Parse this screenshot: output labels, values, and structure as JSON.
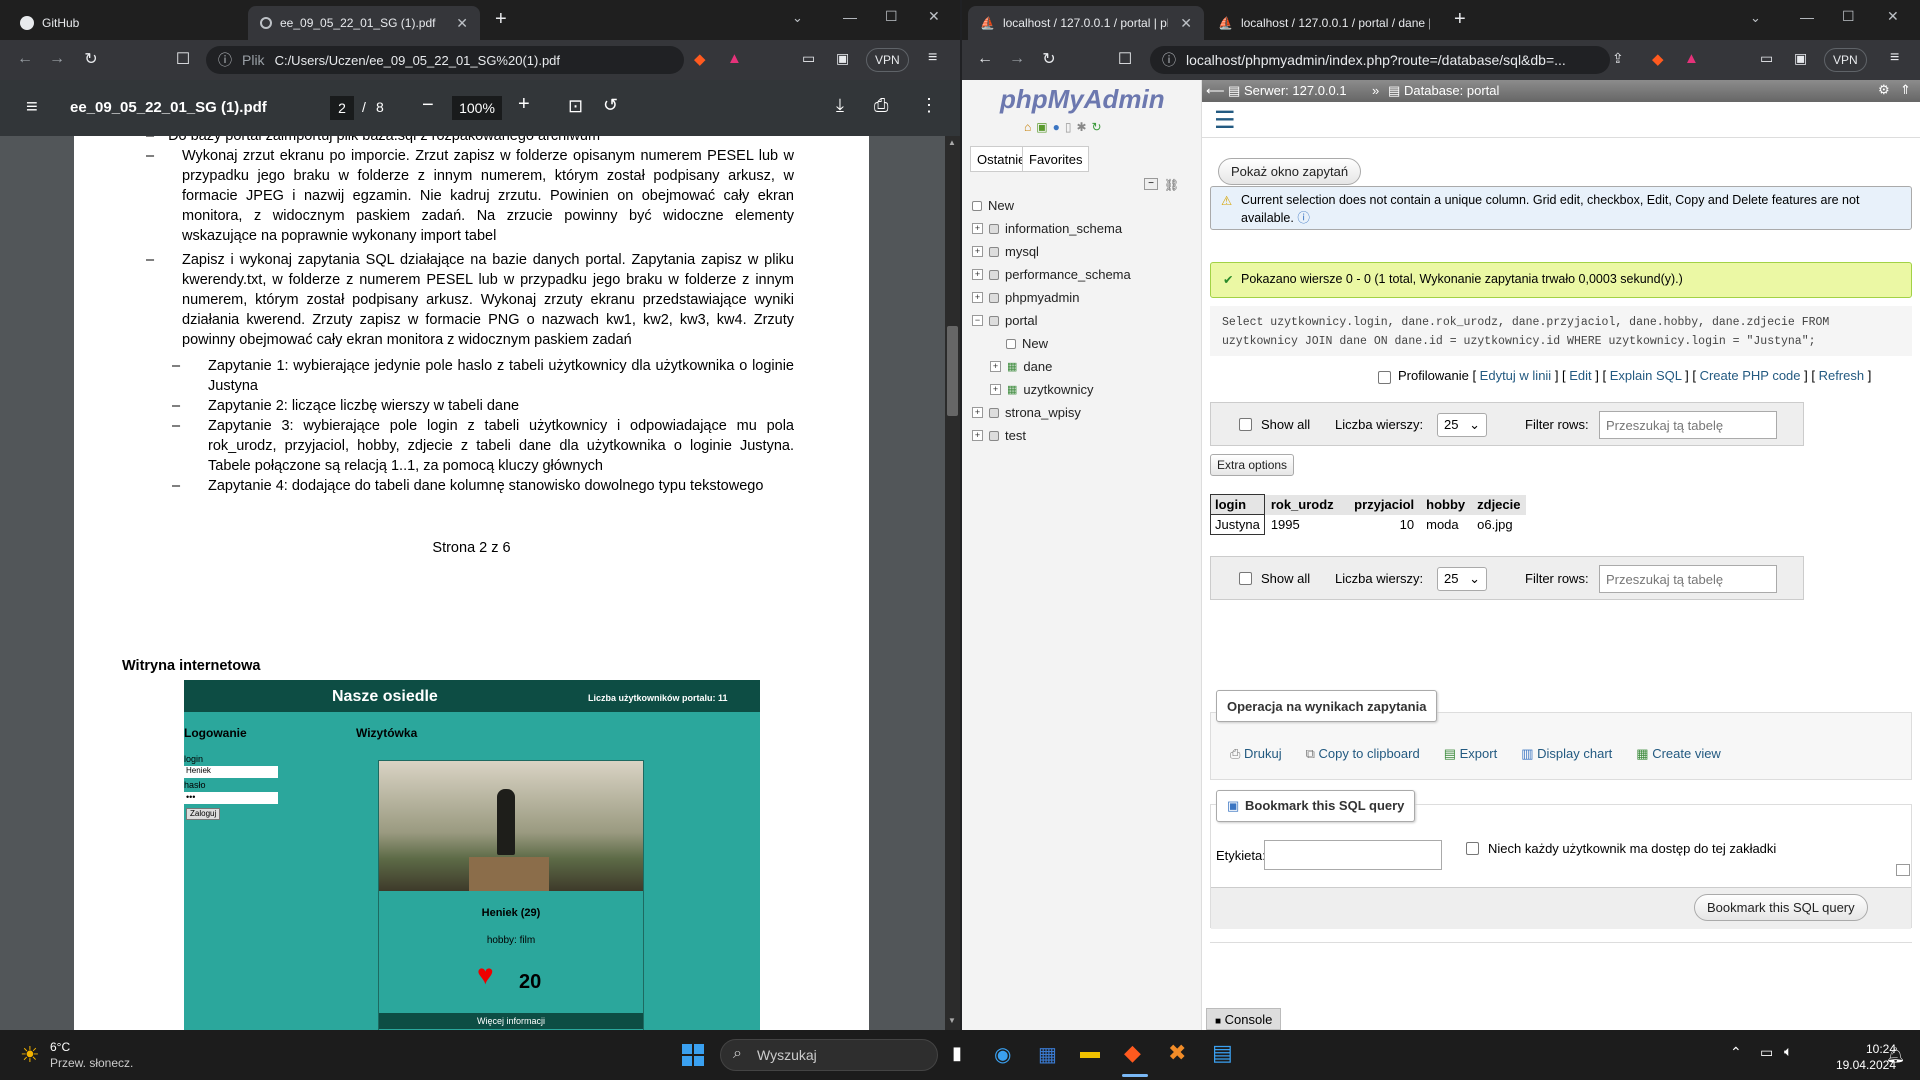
{
  "left_browser": {
    "tabs": [
      {
        "label": "GitHub"
      },
      {
        "label": "ee_09_05_22_01_SG (1).pdf"
      }
    ],
    "address_prefix": "Plik",
    "address": "C:/Users/Uczen/ee_09_05_22_01_SG%20(1).pdf",
    "vpn_label": "VPN",
    "pdf": {
      "title": "ee_09_05_22_01_SG (1).pdf",
      "page_current": "2",
      "page_total": "8",
      "zoom": "100%",
      "page1": {
        "cut_line": "Do bazy portal zaimportuj plik baza.sql z rozpakowanego archiwum",
        "items": [
          {
            "text": "Wykonaj zrzut ekranu po imporcie. Zrzut zapisz w folderze opisanym numerem PESEL lub w przypadku jego braku w folderze z innym numerem, którym został podpisany arkusz, w formacie JPEG i nazwij egzamin. Nie kadruj zrzutu. Powinien on obejmować cały ekran monitora, z widocznym paskiem zadań. Na zrzucie powinny być widoczne elementy wskazujące na poprawnie wykonany import tabel"
          },
          {
            "text": "Zapisz i wykonaj zapytania SQL działające na bazie danych portal. Zapytania zapisz w pliku kwerendy.txt, w folderze z numerem PESEL lub w przypadku jego braku w folderze z innym numerem, którym został podpisany arkusz. Wykonaj zrzuty ekranu przedstawiające wyniki działania kwerend. Zrzuty zapisz w formacie PNG o nazwach kw1, kw2, kw3, kw4. Zrzuty powinny obejmować cały ekran monitora z widocznym paskiem zadań"
          }
        ],
        "subitems": [
          {
            "text": "Zapytanie 1: wybierające jedynie pole haslo z tabeli użytkownicy dla użytkownika o loginie Justyna"
          },
          {
            "text": "Zapytanie 2: liczące liczbę wierszy w tabeli dane"
          },
          {
            "text": "Zapytanie 3: wybierające pole login z tabeli użytkownicy i odpowiadające mu pola rok_urodz, przyjaciol, hobby, zdjecie z tabeli dane dla użytkownika o loginie Justyna. Tabele połączone są relacją 1..1, za pomocą kluczy głównych"
          },
          {
            "text": "Zapytanie 4: dodające do tabeli dane kolumnę stanowisko dowolnego typu tekstowego"
          }
        ],
        "footer": "Strona 2 z 6"
      },
      "page2": {
        "heading": "Witryna internetowa",
        "site_title": "Nasze osiedle",
        "site_count": "Liczba użytkowników portalu: 11",
        "login_heading": "Logowanie",
        "card_heading": "Wizytówka",
        "login_label": "login",
        "login_value": "Heniek",
        "pass_label": "hasło",
        "pass_value": "•••",
        "login_button": "Zaloguj",
        "card_name": "Heniek (29)",
        "card_hobby": "hobby: film",
        "card_likes": "20",
        "card_more": "Więcej informacji"
      }
    }
  },
  "right_browser": {
    "tabs": [
      {
        "label": "localhost / 127.0.0.1 / portal | ph"
      },
      {
        "label": "localhost / 127.0.0.1 / portal / dane |"
      }
    ],
    "address": "localhost/phpmyadmin/index.php?route=/database/sql&db=...",
    "vpn_label": "VPN",
    "pma": {
      "logo": "phpMyAdmin",
      "nav_tabs": [
        "Ostatnie",
        "Favorites"
      ],
      "tree": [
        {
          "label": "New",
          "level": 0
        },
        {
          "label": "information_schema",
          "level": 0
        },
        {
          "label": "mysql",
          "level": 0
        },
        {
          "label": "performance_schema",
          "level": 0
        },
        {
          "label": "phpmyadmin",
          "level": 0
        },
        {
          "label": "portal",
          "level": 0
        },
        {
          "label": "New",
          "level": 1
        },
        {
          "label": "dane",
          "level": 1
        },
        {
          "label": "uzytkownicy",
          "level": 1
        },
        {
          "label": "strona_wpisy",
          "level": 0
        },
        {
          "label": "test",
          "level": 0
        }
      ],
      "breadcrumb_server": "Serwer: 127.0.0.1",
      "breadcrumb_db": "Database: portal",
      "show_query_button": "Pokaż okno zapytań",
      "warning": "Current selection does not contain a unique column. Grid edit, checkbox, Edit, Copy and Delete features are not available.",
      "success": "Pokazano wiersze 0 - 0 (1 total, Wykonanie zapytania trwało 0,0003 sekund(y).)",
      "sql_line1": "Select uzytkownicy.login, dane.rok_urodz, dane.przyjaciol, dane.hobby, dane.zdjecie FROM",
      "sql_line2": "uzytkownicy JOIN dane ON dane.id = uzytkownicy.id WHERE uzytkownicy.login = \"Justyna\";",
      "profiling_label": "Profilowanie",
      "query_links": [
        "Edytuj w linii",
        "Edit",
        "Explain SQL",
        "Create PHP code",
        "Refresh"
      ],
      "show_all": "Show all",
      "rows_label": "Liczba wierszy:",
      "rows_value": "25",
      "filter_label": "Filter rows:",
      "filter_placeholder": "Przeszukaj tą tabelę",
      "extra_options": "Extra options",
      "columns": [
        "login",
        "rok_urodz",
        "przyjaciol",
        "hobby",
        "zdjecie"
      ],
      "rows": [
        [
          "Justyna",
          "1995",
          "10",
          "moda",
          "o6.jpg"
        ]
      ],
      "ops_legend": "Operacja na wynikach zapytania",
      "ops": [
        "Drukuj",
        "Copy to clipboard",
        "Export",
        "Display chart",
        "Create view"
      ],
      "bookmark_legend": "Bookmark this SQL query",
      "label_field": "Etykieta:",
      "bookmark_checkbox": "Niech każdy użytkownik ma dostęp do tej zakładki",
      "bookmark_button": "Bookmark this SQL query",
      "console": "Console"
    }
  },
  "taskbar": {
    "weather_temp": "6°C",
    "weather_desc": "Przew. słonecz.",
    "search_placeholder": "Wyszukaj",
    "time": "10:24",
    "date": "19.04.2024"
  }
}
